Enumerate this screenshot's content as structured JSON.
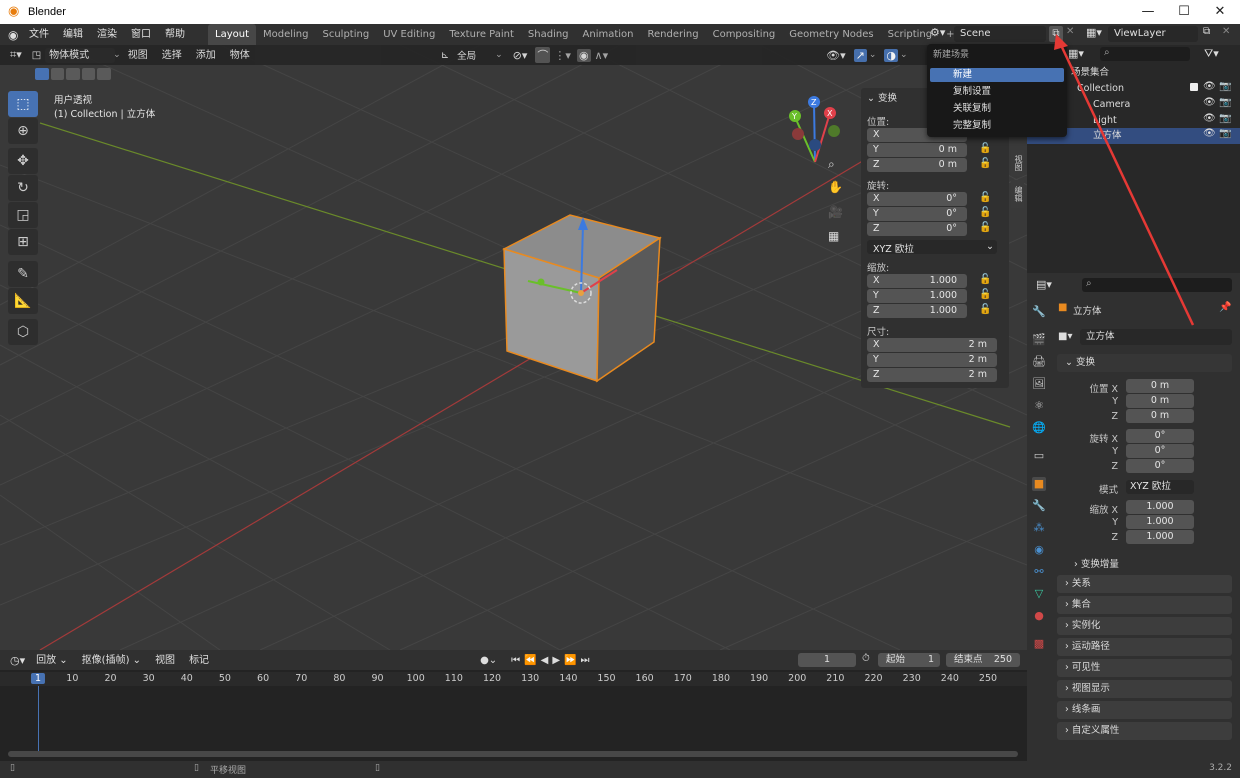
{
  "window": {
    "title": "Blender",
    "minimize": "—",
    "maximize": "☐",
    "close": "✕"
  },
  "menu": [
    "文件",
    "编辑",
    "渲染",
    "窗口",
    "帮助"
  ],
  "workspaces": [
    "Layout",
    "Modeling",
    "Sculpting",
    "UV Editing",
    "Texture Paint",
    "Shading",
    "Animation",
    "Rendering",
    "Compositing",
    "Geometry Nodes",
    "Scripting"
  ],
  "add_workspace": "+",
  "scene": {
    "name": "Scene",
    "view_layer": "ViewLayer"
  },
  "scene_menu": {
    "title": "新建场景",
    "items": [
      "新建",
      "复制设置",
      "关联复制",
      "完整复制"
    ]
  },
  "viewport_header": {
    "mode": "物体模式",
    "menus": [
      "视图",
      "选择",
      "添加",
      "物体"
    ],
    "transform_orientation": "全局"
  },
  "viewport": {
    "view_name": "用户透视",
    "collection_info": "(1) Collection | 立方体"
  },
  "npanel": {
    "section": "变换",
    "location_label": "位置:",
    "location": [
      {
        "axis": "X",
        "value": ""
      },
      {
        "axis": "Y",
        "value": "0 m"
      },
      {
        "axis": "Z",
        "value": "0 m"
      }
    ],
    "rotation_label": "旋转:",
    "rotation": [
      {
        "axis": "X",
        "value": "0°"
      },
      {
        "axis": "Y",
        "value": "0°"
      },
      {
        "axis": "Z",
        "value": "0°"
      }
    ],
    "rotation_mode": "XYZ 欧拉",
    "scale_label": "缩放:",
    "scale": [
      {
        "axis": "X",
        "value": "1.000"
      },
      {
        "axis": "Y",
        "value": "1.000"
      },
      {
        "axis": "Z",
        "value": "1.000"
      }
    ],
    "dimensions_label": "尺寸:",
    "dimensions": [
      {
        "axis": "X",
        "value": "2 m"
      },
      {
        "axis": "Y",
        "value": "2 m"
      },
      {
        "axis": "Z",
        "value": "2 m"
      }
    ],
    "side_tabs": [
      "视图",
      "编辑"
    ]
  },
  "outliner": {
    "items": [
      {
        "label": "场景集合"
      },
      {
        "label": "Collection"
      },
      {
        "label": "Camera"
      },
      {
        "label": "Light"
      },
      {
        "label": "立方体"
      }
    ]
  },
  "properties": {
    "object_name": "立方体",
    "object_field": "立方体",
    "transform_section": "变换",
    "location_x_label": "位置 X",
    "rotation_x_label": "旋转 X",
    "y_label": "Y",
    "z_label": "Z",
    "location": [
      "0 m",
      "0 m",
      "0 m"
    ],
    "rotation": [
      "0°",
      "0°",
      "0°"
    ],
    "mode_label": "模式",
    "mode_value": "XYZ 欧拉",
    "scale_x_label": "缩放 X",
    "scale": [
      "1.000",
      "1.000",
      "1.000"
    ],
    "delta_transform": "变换增量",
    "sections": [
      "关系",
      "集合",
      "实例化",
      "运动路径",
      "可见性",
      "视图显示",
      "线条画",
      "自定义属性"
    ]
  },
  "timeline": {
    "menus": [
      "回放",
      "抠像(插帧)",
      "视图",
      "标记"
    ],
    "current_frame": "1",
    "start_label": "起始",
    "start": "1",
    "end_label": "结束点",
    "end": "250",
    "ruler": [
      "1",
      "10",
      "20",
      "30",
      "40",
      "50",
      "60",
      "70",
      "80",
      "90",
      "100",
      "110",
      "120",
      "130",
      "140",
      "150",
      "160",
      "170",
      "180",
      "190",
      "200",
      "210",
      "220",
      "230",
      "240",
      "250"
    ]
  },
  "statusbar": {
    "hint": "平移视图",
    "version": "3.2.2"
  },
  "colors": {
    "accent": "#4772b3",
    "selected_orange": "#e88a20",
    "arrow_red": "#e53935"
  }
}
